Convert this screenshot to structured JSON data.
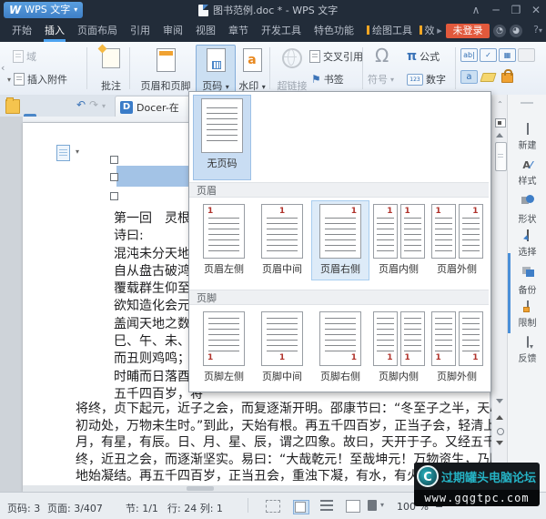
{
  "title_bar": {
    "app_button": "WPS 文字",
    "doc_title": "图书范例.doc * - WPS 文字"
  },
  "menu": {
    "tabs": [
      "开始",
      "插入",
      "页面布局",
      "引用",
      "审阅",
      "视图",
      "章节",
      "开发工具",
      "特色功能",
      "绘图工具",
      "效果"
    ],
    "login": "未登录"
  },
  "ribbon": {
    "field": "域",
    "attach": "插入附件",
    "comment": "批注",
    "header_footer": "页眉和页脚",
    "page_number": "页码",
    "watermark": "水印",
    "hyperlink": "超链接",
    "cross_ref": "交叉引用",
    "bookmark": "书签",
    "symbol": "符号",
    "formula": "公式",
    "number": "数字"
  },
  "tab_row": {
    "docer": "Docer-在"
  },
  "panel": {
    "digit": "1",
    "none": "无页码",
    "header_title": "页眉",
    "footer_title": "页脚",
    "header_options": [
      "页眉左侧",
      "页眉中间",
      "页眉右侧",
      "页眉内侧",
      "页眉外侧"
    ],
    "footer_options": [
      "页脚左侧",
      "页脚中间",
      "页脚右侧",
      "页脚内侧",
      "页脚外侧"
    ]
  },
  "document": {
    "left_lines": [
      "第一回　灵根育",
      "诗曰:",
      "混沌未分天地乱",
      "自从盘古破鸿蒙",
      "覆载群生仰至仁",
      "欲知造化会元功",
      "盖闻天地之数，",
      "巳、午、未、申",
      "而丑则鸡鸣；寅",
      "时晡而日落酉，",
      "五千四百岁，将"
    ],
    "full_lines": [
      "将终，贞下起元，近子之会，而复逐渐开明。邵康节曰：“冬至子之半，天心",
      "初动处，万物未生时。”到此，天始有根。再五千四百岁，正当子会，轻清上",
      "月，有星，有辰。日、月、星、辰，谓之四象。故曰，天开于子。又经五千四",
      "终，近丑之会，而逐渐坚实。易曰：“大哉乾元！至哉坤元！万物资生，乃顺",
      "地始凝结。再五千四百岁，正当丑会，重浊下凝，有水，有火，有山，有石"
    ]
  },
  "sidebar": {
    "items": [
      "新建",
      "样式",
      "形状",
      "选择",
      "备份",
      "限制",
      "反馈"
    ]
  },
  "status": {
    "page": "页码: 3",
    "pages": "页面: 3/407",
    "section": "节: 1/1",
    "line_col": "行: 24 列: 1",
    "zoom": "100 %",
    "minus": "−"
  },
  "watermark": {
    "title": "过期罐头电脑论坛",
    "url": "www.gqgtpc.com"
  },
  "glyphs": {
    "w_logo": "W",
    "collapse_win": "∧",
    "minimize": "─",
    "maximize": "❐",
    "close": "✕",
    "caret": "▾",
    "more": "▸",
    "back": "‹",
    "omega": "Ω",
    "pi": "π",
    "num123": "123",
    "abl": "ab|",
    "check": "✓",
    "combo": "▦",
    "letter_a": "a",
    "undo": "↶",
    "redo": "↷",
    "help": "?",
    "flag": "⚑",
    "crossref_arrow": "↪",
    "docer_d": "D",
    "logo_c": "C",
    "style_A": "A",
    "style_slash": "⁄",
    "msg1": "◔",
    "msg2": "◕",
    "shirt": "👕"
  }
}
